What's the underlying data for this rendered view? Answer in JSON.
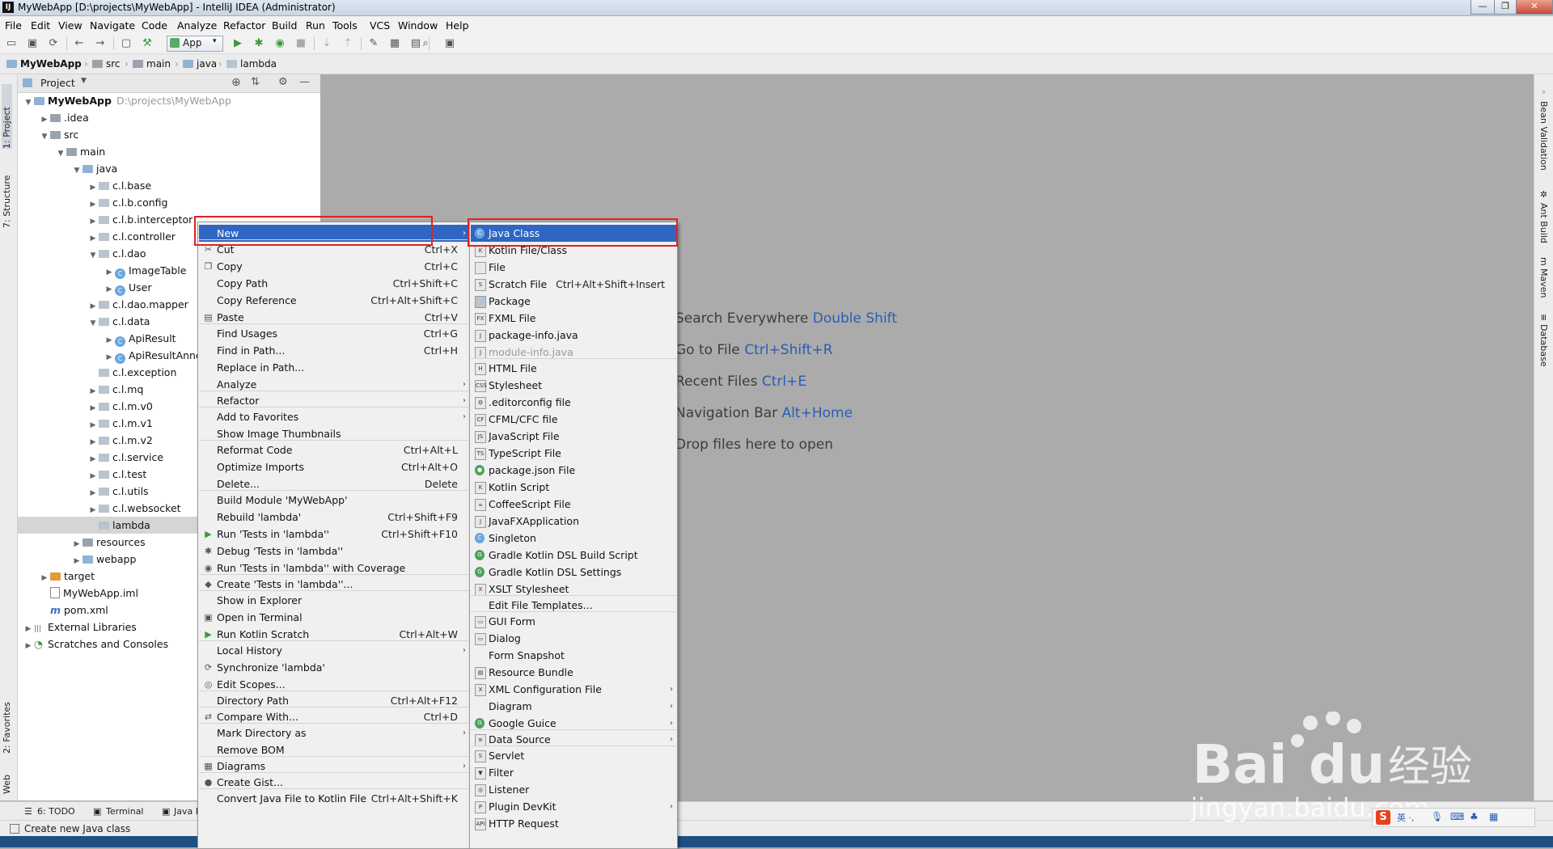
{
  "window": {
    "title": "MyWebApp [D:\\projects\\MyWebApp] - IntelliJ IDEA (Administrator)",
    "logo": "IJ"
  },
  "menubar": [
    "File",
    "Edit",
    "View",
    "Navigate",
    "Code",
    "Analyze",
    "Refactor",
    "Build",
    "Run",
    "Tools",
    "VCS",
    "Window",
    "Help"
  ],
  "toolbar": {
    "run_config": "App"
  },
  "breadcrumbs": [
    "MyWebApp",
    "src",
    "main",
    "java",
    "lambda"
  ],
  "left_strip": [
    "1: Project",
    "7: Structure",
    "2: Favorites",
    "Web"
  ],
  "right_strip": [
    "Bean Validation",
    "Ant Build",
    "Maven",
    "Database"
  ],
  "project_panel": {
    "header": "Project",
    "tree": [
      {
        "label": "MyWebApp",
        "path": "D:\\projects\\MyWebApp",
        "indent": 0,
        "arrow": "down",
        "icon": "module"
      },
      {
        "label": ".idea",
        "indent": 1,
        "arrow": "right",
        "icon": "folder-gray"
      },
      {
        "label": "src",
        "indent": 1,
        "arrow": "down",
        "icon": "folder-gray"
      },
      {
        "label": "main",
        "indent": 2,
        "arrow": "down",
        "icon": "folder-gray"
      },
      {
        "label": "java",
        "indent": 3,
        "arrow": "down",
        "icon": "folder-blue"
      },
      {
        "label": "c.l.base",
        "indent": 4,
        "arrow": "right",
        "icon": "package"
      },
      {
        "label": "c.l.b.config",
        "indent": 4,
        "arrow": "right",
        "icon": "package"
      },
      {
        "label": "c.l.b.interceptor",
        "indent": 4,
        "arrow": "right",
        "icon": "package"
      },
      {
        "label": "c.l.controller",
        "indent": 4,
        "arrow": "right",
        "icon": "package"
      },
      {
        "label": "c.l.dao",
        "indent": 4,
        "arrow": "down",
        "icon": "package"
      },
      {
        "label": "ImageTable",
        "indent": 5,
        "arrow": "right",
        "icon": "class"
      },
      {
        "label": "User",
        "indent": 5,
        "arrow": "right",
        "icon": "class"
      },
      {
        "label": "c.l.dao.mapper",
        "indent": 4,
        "arrow": "right",
        "icon": "package"
      },
      {
        "label": "c.l.data",
        "indent": 4,
        "arrow": "down",
        "icon": "package"
      },
      {
        "label": "ApiResult",
        "indent": 5,
        "arrow": "right",
        "icon": "class"
      },
      {
        "label": "ApiResultAnno",
        "indent": 5,
        "arrow": "right",
        "icon": "class"
      },
      {
        "label": "c.l.exception",
        "indent": 4,
        "arrow": "none",
        "icon": "package"
      },
      {
        "label": "c.l.mq",
        "indent": 4,
        "arrow": "right",
        "icon": "package"
      },
      {
        "label": "c.l.m.v0",
        "indent": 4,
        "arrow": "right",
        "icon": "package"
      },
      {
        "label": "c.l.m.v1",
        "indent": 4,
        "arrow": "right",
        "icon": "package"
      },
      {
        "label": "c.l.m.v2",
        "indent": 4,
        "arrow": "right",
        "icon": "package"
      },
      {
        "label": "c.l.service",
        "indent": 4,
        "arrow": "right",
        "icon": "package"
      },
      {
        "label": "c.l.test",
        "indent": 4,
        "arrow": "right",
        "icon": "package"
      },
      {
        "label": "c.l.utils",
        "indent": 4,
        "arrow": "right",
        "icon": "package"
      },
      {
        "label": "c.l.websocket",
        "indent": 4,
        "arrow": "right",
        "icon": "package"
      },
      {
        "label": "lambda",
        "indent": 4,
        "arrow": "none",
        "icon": "package",
        "selected": true
      },
      {
        "label": "resources",
        "indent": 3,
        "arrow": "right",
        "icon": "folder-gray"
      },
      {
        "label": "webapp",
        "indent": 3,
        "arrow": "right",
        "icon": "folder-blue"
      },
      {
        "label": "target",
        "indent": 1,
        "arrow": "right",
        "icon": "folder-orange"
      },
      {
        "label": "MyWebApp.iml",
        "indent": 1,
        "arrow": "none",
        "icon": "file"
      },
      {
        "label": "pom.xml",
        "indent": 1,
        "arrow": "none",
        "icon": "maven"
      },
      {
        "label": "External Libraries",
        "indent": 0,
        "arrow": "right",
        "icon": "libs"
      },
      {
        "label": "Scratches and Consoles",
        "indent": 0,
        "arrow": "right",
        "icon": "scratch"
      }
    ]
  },
  "editor_hints": [
    {
      "text": "Search Everywhere ",
      "key": "Double Shift"
    },
    {
      "text": "Go to File ",
      "key": "Ctrl+Shift+R"
    },
    {
      "text": "Recent Files ",
      "key": "Ctrl+E"
    },
    {
      "text": "Navigation Bar ",
      "key": "Alt+Home"
    },
    {
      "text": "Drop files here to open",
      "key": ""
    }
  ],
  "context_menu": [
    {
      "label": "New",
      "sub": true,
      "selected": true
    },
    {
      "sep": true
    },
    {
      "label": "Cut",
      "shortcut": "Ctrl+X",
      "icon": "scissors-icon"
    },
    {
      "label": "Copy",
      "shortcut": "Ctrl+C",
      "icon": "copy-icon"
    },
    {
      "label": "Copy Path",
      "shortcut": "Ctrl+Shift+C"
    },
    {
      "label": "Copy Reference",
      "shortcut": "Ctrl+Alt+Shift+C"
    },
    {
      "label": "Paste",
      "shortcut": "Ctrl+V",
      "icon": "paste-icon"
    },
    {
      "sep": true
    },
    {
      "label": "Find Usages",
      "shortcut": "Ctrl+G"
    },
    {
      "label": "Find in Path...",
      "shortcut": "Ctrl+H"
    },
    {
      "label": "Replace in Path..."
    },
    {
      "label": "Analyze",
      "sub": true
    },
    {
      "sep": true
    },
    {
      "label": "Refactor",
      "sub": true
    },
    {
      "sep": true
    },
    {
      "label": "Add to Favorites",
      "sub": true
    },
    {
      "label": "Show Image Thumbnails"
    },
    {
      "sep": true
    },
    {
      "label": "Reformat Code",
      "shortcut": "Ctrl+Alt+L"
    },
    {
      "label": "Optimize Imports",
      "shortcut": "Ctrl+Alt+O"
    },
    {
      "label": "Delete...",
      "shortcut": "Delete"
    },
    {
      "sep": true
    },
    {
      "label": "Build Module 'MyWebApp'"
    },
    {
      "label": "Rebuild 'lambda'",
      "shortcut": "Ctrl+Shift+F9"
    },
    {
      "label": "Run 'Tests in 'lambda''",
      "shortcut": "Ctrl+Shift+F10",
      "icon": "run-icon"
    },
    {
      "label": "Debug 'Tests in 'lambda''",
      "icon": "debug-icon"
    },
    {
      "label": "Run 'Tests in 'lambda'' with Coverage",
      "icon": "coverage-icon"
    },
    {
      "sep": true
    },
    {
      "label": "Create 'Tests in 'lambda''...",
      "icon": "create-test-icon"
    },
    {
      "sep": true
    },
    {
      "label": "Show in Explorer"
    },
    {
      "label": "Open in Terminal",
      "icon": "terminal-icon"
    },
    {
      "label": "Run Kotlin Scratch",
      "shortcut": "Ctrl+Alt+W",
      "icon": "run-icon"
    },
    {
      "sep": true
    },
    {
      "label": "Local History",
      "sub": true
    },
    {
      "label": "Synchronize 'lambda'",
      "icon": "sync-icon"
    },
    {
      "label": "Edit Scopes...",
      "icon": "scope-icon"
    },
    {
      "sep": true
    },
    {
      "label": "Directory Path",
      "shortcut": "Ctrl+Alt+F12"
    },
    {
      "sep": true
    },
    {
      "label": "Compare With...",
      "shortcut": "Ctrl+D",
      "icon": "compare-icon"
    },
    {
      "sep": true
    },
    {
      "label": "Mark Directory as",
      "sub": true
    },
    {
      "label": "Remove BOM"
    },
    {
      "sep": true
    },
    {
      "label": "Diagrams",
      "sub": true,
      "icon": "diagram-icon"
    },
    {
      "sep": true
    },
    {
      "label": "Create Gist...",
      "icon": "github-icon"
    },
    {
      "sep": true
    },
    {
      "label": "Convert Java File to Kotlin File",
      "shortcut": "Ctrl+Alt+Shift+K"
    }
  ],
  "new_submenu": [
    {
      "label": "Java Class",
      "icon": "java-class-icon",
      "selected": true
    },
    {
      "label": "Kotlin File/Class",
      "icon": "kotlin-icon"
    },
    {
      "label": "File",
      "icon": "file-icon"
    },
    {
      "label": "Scratch File",
      "shortcut": "Ctrl+Alt+Shift+Insert",
      "icon": "scratch-icon"
    },
    {
      "label": "Package",
      "icon": "package-icon"
    },
    {
      "label": "FXML File",
      "icon": "fxml-icon"
    },
    {
      "label": "package-info.java",
      "icon": "java-file-icon"
    },
    {
      "label": "module-info.java",
      "icon": "java-file-icon",
      "disabled": true
    },
    {
      "sep": true
    },
    {
      "label": "HTML File",
      "icon": "html-icon"
    },
    {
      "label": "Stylesheet",
      "icon": "css-icon"
    },
    {
      "label": ".editorconfig file",
      "icon": "editorconfig-icon"
    },
    {
      "label": "CFML/CFC file",
      "icon": "cfml-icon"
    },
    {
      "label": "JavaScript File",
      "icon": "js-icon"
    },
    {
      "label": "TypeScript File",
      "icon": "ts-icon"
    },
    {
      "label": "package.json File",
      "icon": "npm-icon"
    },
    {
      "label": "Kotlin Script",
      "icon": "kotlin-icon"
    },
    {
      "label": "CoffeeScript File",
      "icon": "coffee-icon"
    },
    {
      "label": "JavaFXApplication",
      "icon": "javafx-icon"
    },
    {
      "label": "Singleton",
      "icon": "java-class-icon"
    },
    {
      "label": "Gradle Kotlin DSL Build Script",
      "icon": "gradle-icon"
    },
    {
      "label": "Gradle Kotlin DSL Settings",
      "icon": "gradle-icon"
    },
    {
      "label": "XSLT Stylesheet",
      "icon": "xslt-icon"
    },
    {
      "sep": true
    },
    {
      "label": "Edit File Templates..."
    },
    {
      "sep": true
    },
    {
      "label": "GUI Form",
      "icon": "form-icon"
    },
    {
      "label": "Dialog",
      "icon": "dialog-icon"
    },
    {
      "label": "Form Snapshot"
    },
    {
      "label": "Resource Bundle",
      "icon": "bundle-icon"
    },
    {
      "label": "XML Configuration File",
      "icon": "xml-icon",
      "sub": true
    },
    {
      "label": "Diagram",
      "sub": true
    },
    {
      "label": "Google Guice",
      "icon": "guice-icon",
      "sub": true
    },
    {
      "sep": true
    },
    {
      "label": "Data Source",
      "icon": "database-icon",
      "sub": true
    },
    {
      "sep": true
    },
    {
      "label": "Servlet",
      "icon": "servlet-icon"
    },
    {
      "label": "Filter",
      "icon": "filter-icon"
    },
    {
      "label": "Listener",
      "icon": "listener-icon"
    },
    {
      "label": "Plugin DevKit",
      "icon": "plugin-icon",
      "sub": true
    },
    {
      "label": "HTTP Request",
      "icon": "http-icon"
    }
  ],
  "bottom_tabs": [
    "6: TODO",
    "Terminal",
    "Java E"
  ],
  "status": {
    "text": "Create new Java class"
  },
  "watermark": {
    "brand": "Bai",
    "brand2": "du",
    "cn": "经验",
    "url": "jingyan.baidu.com"
  },
  "colors": {
    "selection": "#2f66c4",
    "highlight_box": "#e32020",
    "hint_key": "#2a5cb8"
  }
}
